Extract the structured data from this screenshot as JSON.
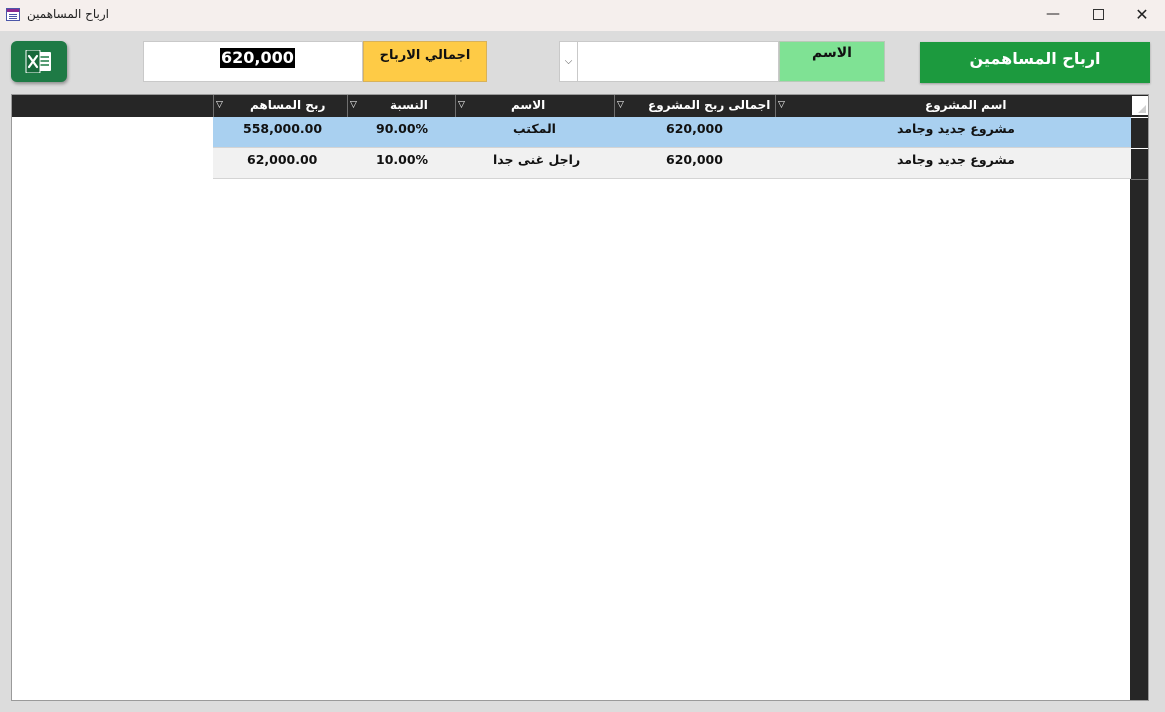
{
  "window": {
    "title": "ارباح المساهمين",
    "minimize": "—",
    "close": "✕"
  },
  "controls": {
    "excel_icon": "excel-icon",
    "total_value": "620,000",
    "total_label": "اجمالي الارباح",
    "combo_arrow": "⌵",
    "combo_value": "",
    "name_label": "الاسم",
    "title_button": "ارباح المساهمين"
  },
  "colors": {
    "excel": "#1e7a45",
    "total_label_bg": "#fecb46",
    "name_label_bg": "#7fe294",
    "title_button_bg": "#1c9a3e",
    "selected_row": "#a9d0f0",
    "header_bg": "#262626"
  },
  "table": {
    "columns": [
      "اسم المشروع",
      "اجمالى ربح المشروع",
      "الاسم",
      "النسبة",
      "ربح المساهم"
    ],
    "filter_glyph": "▽",
    "rows": [
      {
        "project": "مشروع جديد وجامد",
        "project_total": "620,000",
        "name": "المكتب",
        "percent": "90.00%",
        "profit": "558,000.00",
        "selected": true
      },
      {
        "project": "مشروع جديد وجامد",
        "project_total": "620,000",
        "name": "راجل غنى جدا",
        "percent": "10.00%",
        "profit": "62,000.00",
        "selected": false
      }
    ]
  }
}
